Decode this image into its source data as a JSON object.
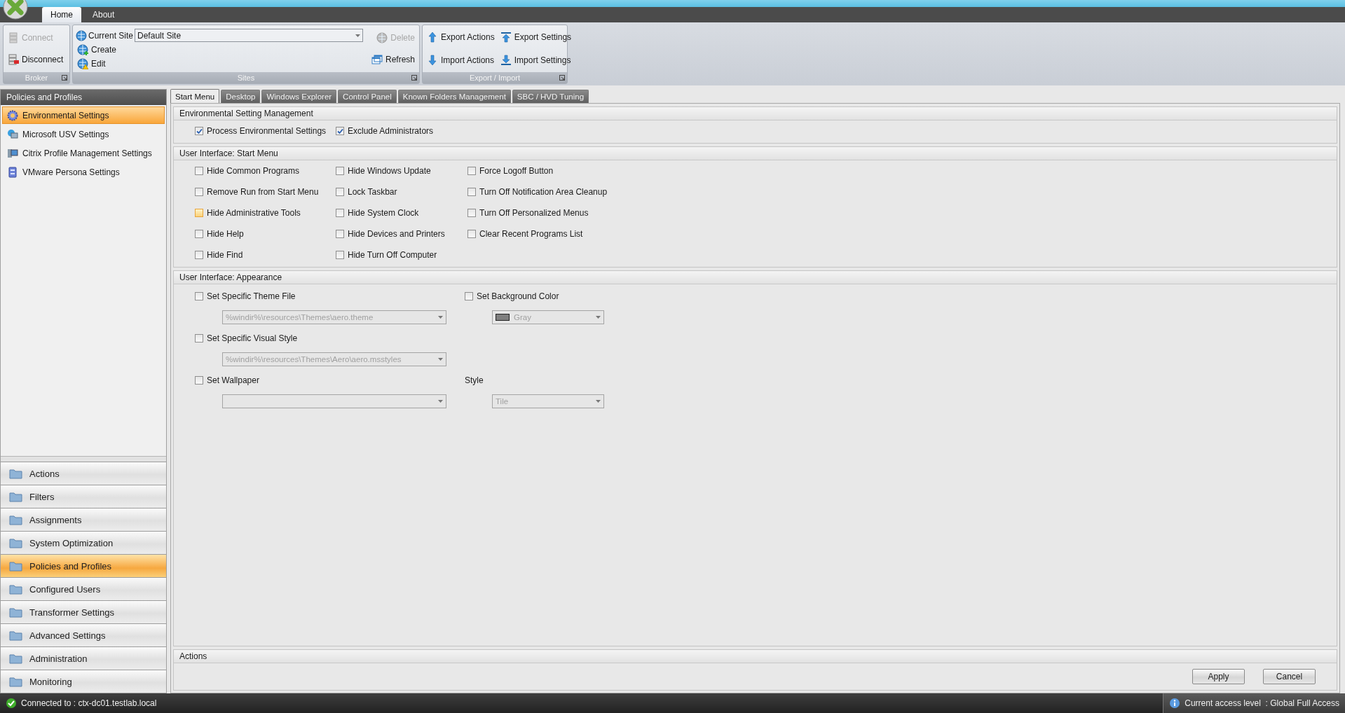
{
  "ribbon_tabs": [
    {
      "label": "Home",
      "selected": true
    },
    {
      "label": "About",
      "selected": false
    }
  ],
  "broker": {
    "title": "Broker",
    "buttons": [
      {
        "kind": "connect",
        "label": "Connect",
        "disabled": true
      },
      {
        "kind": "disconnect",
        "label": "Disconnect",
        "disabled": false
      }
    ]
  },
  "sites": {
    "title": "Sites",
    "current_site": {
      "label": "Current Site",
      "value": "Default Site"
    },
    "left_buttons": [
      {
        "kind": "create",
        "label": "Create",
        "disabled": false
      },
      {
        "kind": "edit",
        "label": "Edit",
        "disabled": false
      }
    ],
    "right_buttons": [
      {
        "kind": "delete",
        "label": "Delete",
        "disabled": true
      },
      {
        "kind": "refresh",
        "label": "Refresh",
        "disabled": false
      }
    ]
  },
  "export_import": {
    "title": "Export / Import",
    "buttons": [
      {
        "kind": "export",
        "label": "Export Actions",
        "disabled": false
      },
      {
        "kind": "export_big",
        "label": "Export Settings",
        "disabled": false
      },
      {
        "kind": "import",
        "label": "Import Actions",
        "disabled": false
      },
      {
        "kind": "import_big",
        "label": "Import Settings",
        "disabled": false
      }
    ]
  },
  "sidebar": {
    "title": "Policies and Profiles",
    "items": [
      {
        "kind": "gear",
        "label": "Environmental Settings",
        "selected": true
      },
      {
        "kind": "monitor",
        "label": "Microsoft USV Settings",
        "selected": false
      },
      {
        "kind": "computer",
        "label": "Citrix Profile Management Settings",
        "selected": false
      },
      {
        "kind": "server",
        "label": "VMware Persona Settings",
        "selected": false
      }
    ]
  },
  "nav": [
    {
      "label": "Actions",
      "selected": false
    },
    {
      "label": "Filters",
      "selected": false
    },
    {
      "label": "Assignments",
      "selected": false
    },
    {
      "label": "System Optimization",
      "selected": false
    },
    {
      "label": "Policies and Profiles",
      "selected": true
    },
    {
      "label": "Configured Users",
      "selected": false
    },
    {
      "label": "Transformer Settings",
      "selected": false
    },
    {
      "label": "Advanced Settings",
      "selected": false
    },
    {
      "label": "Administration",
      "selected": false
    },
    {
      "label": "Monitoring",
      "selected": false
    }
  ],
  "content_tabs": [
    {
      "label": "Start Menu",
      "selected": true
    },
    {
      "label": "Desktop",
      "selected": false
    },
    {
      "label": "Windows Explorer",
      "selected": false
    },
    {
      "label": "Control Panel",
      "selected": false
    },
    {
      "label": "Known Folders Management",
      "selected": false
    },
    {
      "label": "SBC / HVD Tuning",
      "selected": false
    }
  ],
  "sections": [
    {
      "kind": "checks",
      "title": "Environmental Setting Management",
      "columns": [
        [
          {
            "label": "Process Environmental Settings",
            "checked": true,
            "highlighted": false
          }
        ],
        [
          {
            "label": "Exclude Administrators",
            "checked": true,
            "highlighted": false
          }
        ]
      ]
    },
    {
      "kind": "checks",
      "title": "User Interface: Start Menu",
      "columns": [
        [
          {
            "label": "Hide Common Programs",
            "checked": false,
            "highlighted": false
          },
          {
            "label": "Remove Run from Start Menu",
            "checked": false,
            "highlighted": false
          },
          {
            "label": "Hide Administrative Tools",
            "checked": false,
            "highlighted": true
          },
          {
            "label": "Hide Help",
            "checked": false,
            "highlighted": false
          },
          {
            "label": "Hide Find",
            "checked": false,
            "highlighted": false
          }
        ],
        [
          {
            "label": "Hide Windows Update",
            "checked": false,
            "highlighted": false
          },
          {
            "label": "Lock Taskbar",
            "checked": false,
            "highlighted": false
          },
          {
            "label": "Hide System Clock",
            "checked": false,
            "highlighted": false
          },
          {
            "label": "Hide Devices and Printers",
            "checked": false,
            "highlighted": false
          },
          {
            "label": "Hide Turn Off Computer",
            "checked": false,
            "highlighted": false
          }
        ],
        [
          {
            "label": "Force Logoff Button",
            "checked": false,
            "highlighted": false
          },
          {
            "label": "Turn Off Notification Area Cleanup",
            "checked": false,
            "highlighted": false
          },
          {
            "label": "Turn Off Personalized Menus",
            "checked": false,
            "highlighted": false
          },
          {
            "label": "Clear Recent Programs List",
            "checked": false,
            "highlighted": false
          }
        ]
      ]
    },
    {
      "kind": "appearance",
      "title": "User Interface: Appearance",
      "rows": [
        [
          {
            "kind": "checkbox",
            "label": "Set Specific Theme File",
            "checked": false,
            "dropdown": {
              "value": "%windir%\\resources\\Themes\\aero.theme",
              "disabled": true
            }
          },
          {
            "kind": "checkbox",
            "label": "Set Background Color",
            "checked": false,
            "dropdown": {
              "value": "Gray",
              "disabled": true,
              "color": "#7f7f7f"
            }
          }
        ],
        [
          {
            "kind": "checkbox",
            "label": "Set Specific Visual Style",
            "checked": false,
            "dropdown": {
              "value": "%windir%\\resources\\Themes\\Aero\\aero.msstyles",
              "disabled": true
            }
          }
        ],
        [
          {
            "kind": "checkbox",
            "label": "Set Wallpaper",
            "checked": false,
            "dropdown": {
              "disabled": true
            }
          },
          {
            "kind": "label",
            "label": "Style",
            "dropdown": {
              "value": "Tile",
              "disabled": true
            }
          }
        ]
      ]
    },
    {
      "kind": "actions",
      "title": "Actions",
      "buttons": [
        {
          "label": "Apply"
        },
        {
          "label": "Cancel"
        }
      ]
    }
  ],
  "status_bar": {
    "connection": "Connected to : ctx-dc01.testlab.local",
    "access": "Current access level  : Global Full Access"
  }
}
